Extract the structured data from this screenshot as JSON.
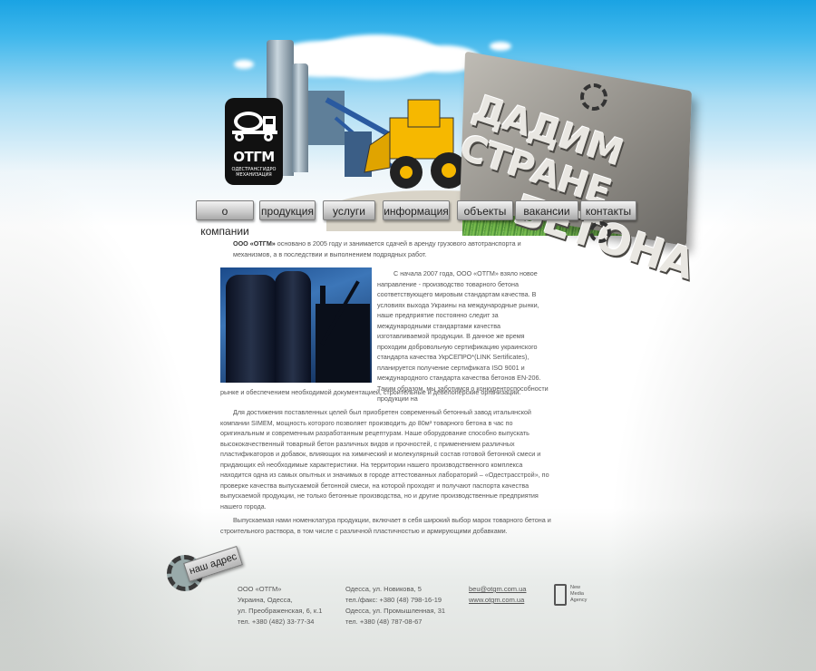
{
  "logo": {
    "name": "ОТГМ",
    "subtitle": "ОДЕСТРАНСГИДРО МЕХАНИЗАЦИЯ"
  },
  "slogan": {
    "line1": "ДАДИМ СТРАНЕ",
    "line2": "БЕТОНА"
  },
  "nav": {
    "items": [
      {
        "label": "о компании"
      },
      {
        "label": "продукция"
      },
      {
        "label": "услуги"
      },
      {
        "label": "информация"
      },
      {
        "label": "объекты"
      },
      {
        "label": "вакансии"
      },
      {
        "label": "контакты"
      }
    ]
  },
  "content": {
    "intro_company": "ООО «ОТГМ»",
    "intro_rest": " основано в 2005 году и занимается сдачей в аренду грузового автотранспорта и механизмов, а в последствии и выполнением подрядных работ.",
    "para2": "С начала 2007 года, ООО «ОТГМ» взяло новое направление - производство товарного бетона соответствующего мировым стандартам качества. В условиях выхода Украины на международные рынки, наше предприятие постоянно следит за международными стандартами качества изготавливаемой продукции. В данное же время проходим добровольную сертификацию украинского стандарта качества УкрСЕПРО*(LINK Sertificates), планируется получение сертификата ISO 9001 и международного стандарта качества бетонов EN-206. Таким образом, мы заботимся о конкурентоспособности продукции на",
    "para2_cont": "рынке и обеспечением необходимой документацией, строительные и девелоперские организации.",
    "para3": "Для достижения поставленных целей был приобретен современный бетонный завод итальянской компании SIMEM, мощность которого позволяет производить до 80м³ товарного бетона в час по оригинальным и современным разработанным рецептурам. Наше оборудование способно выпускать высококачественный товарный бетон различных видов и прочностей, с применением различных пластификаторов и добавок, влияющих на химический и молекулярный состав готовой бетонной смеси и придающих ей необходимые характеристики. На территории нашего производственного комплекса находится одна из самых опытных и значимых в городе аттестованных лабораторий – «Одестрасстрой», по проверке качества выпускаемой бетонной смеси, на которой проходят и получают паспорта качества выпускаемой продукции, не только бетонные производства, но и другие производственные предприятия нашего города.",
    "para4": "Выпускаемая нами номенклатура продукции, включает в себя широкий выбор марок товарного бетона и строительного раствора, в том числе с различной пластичностью и армирующими добавками."
  },
  "footer": {
    "address_tag": "наш адрес",
    "col1": [
      "ООО «ОТГМ»",
      "Украина, Одесса,",
      "ул. Преображенская, 6, к.1",
      "тел. +380 (482) 33-77-34"
    ],
    "col2": [
      "Одесса, ул. Новикова, 5",
      "тел./факс: +380 (48) 798-16-19",
      "Одесса, ул. Промышленная, 31",
      "тел. +380 (48) 787-08-67"
    ],
    "email": "beu@otgm.com.ua",
    "site": "www.otgm.com.ua",
    "agency": [
      "New",
      "Media",
      "Agency"
    ]
  }
}
